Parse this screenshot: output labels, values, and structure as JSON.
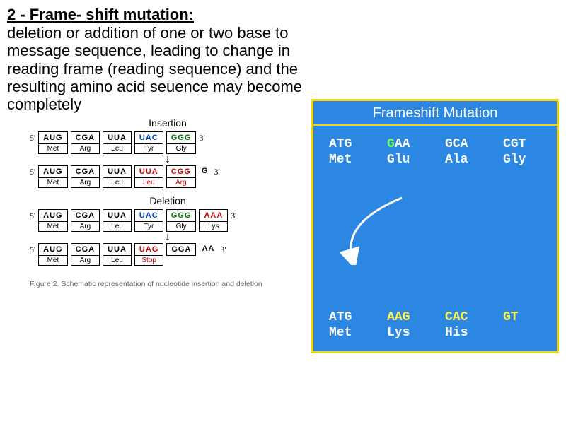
{
  "title": "2 - Frame- shift mutation:",
  "description": "deletion or addition of one or two base to message sequence, leading to change in reading frame (reading sequence) and the resulting amino acid seuence may become completely",
  "leftFigure": {
    "insertion": {
      "label": "Insertion",
      "before": {
        "five": "5'",
        "three": "3'",
        "codons": [
          "AUG",
          "CGA",
          "UUA",
          "UAC",
          "GGG"
        ],
        "aas": [
          "Met",
          "Arg",
          "Leu",
          "Tyr",
          "Gly"
        ]
      },
      "after": {
        "five": "5'",
        "three": "3'",
        "codons": [
          "AUG",
          "CGA",
          "UUA",
          "UUA",
          "CGG",
          "G"
        ],
        "aas": [
          "Met",
          "Arg",
          "Leu",
          "Leu",
          "Arg",
          ""
        ]
      }
    },
    "deletion": {
      "label": "Deletion",
      "before": {
        "five": "5'",
        "three": "3'",
        "codons": [
          "AUG",
          "CGA",
          "UUA",
          "UAC",
          "GGG",
          "AAA"
        ],
        "aas": [
          "Met",
          "Arg",
          "Leu",
          "Tyr",
          "Gly",
          "Lys"
        ]
      },
      "after": {
        "five": "5'",
        "three": "3'",
        "codons": [
          "AUG",
          "CGA",
          "UUA",
          "UAG",
          "GGA",
          "AA"
        ],
        "aas": [
          "Met",
          "Arg",
          "Leu",
          "Stop",
          "",
          ""
        ]
      }
    },
    "caption": "Figure 2. Schematic representation of nucleotide insertion and deletion"
  },
  "rightPanel": {
    "title": "Frameshift Mutation",
    "before": {
      "codons": [
        "ATG",
        "GAA",
        "GCA",
        "CGT"
      ],
      "aas": [
        "Met",
        "Glu",
        "Ala",
        "Gly"
      ],
      "mutantBase": "G"
    },
    "after": {
      "codons": [
        "ATG",
        "AAG",
        "CAC",
        "GT"
      ],
      "aas": [
        "Met",
        "Lys",
        "His",
        ""
      ]
    }
  }
}
